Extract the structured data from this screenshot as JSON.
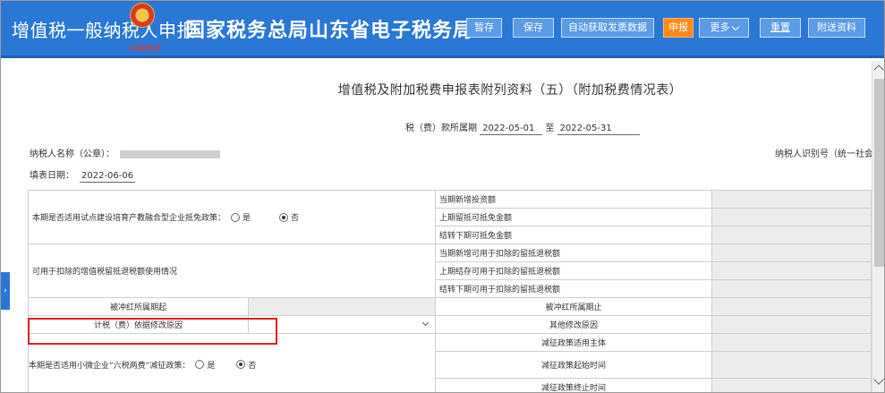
{
  "header": {
    "title_left": "增值税一般纳税人申报",
    "title_main": "国家税务总局山东省电子税务局",
    "emblem_sub": "中国税务",
    "buttons": {
      "stash": "暂存",
      "save": "保存",
      "auto_fetch": "自动获取发票数据",
      "declare": "申报",
      "more": "更多",
      "reset": "重置",
      "attach": "附送资料"
    },
    "accent_color": "#2a77d6",
    "active_color": "#ff8a1c"
  },
  "doc": {
    "title": "增值税及附加税费申报表附列资料（五）（附加税费情况表）",
    "period_label": "税（费）款所属期",
    "period_start": "2022-05-01",
    "period_to": "至",
    "period_end": "2022-05-31",
    "taxpayer_label": "纳税人名称（公章）：",
    "taxpayer_id_label": "纳税人识别号（统一社会信",
    "fill_date_label": "填表日期：",
    "fill_date": "2022-06-06"
  },
  "table": {
    "row1_label": "本期是否适用试点建设培育产教融合型企业抵免政策：",
    "yes": "是",
    "no": "否",
    "r1_items": [
      "当期新增投资额",
      "上期留抵可抵免金额",
      "结转下期可抵免金额"
    ],
    "row2_label": "可用于扣除的增值税留抵退税额使用情况",
    "r2_items": [
      "当期新增可用于扣除的留抵退税额",
      "上期结存可用于扣除的留抵退税额",
      "结转下期可用于扣除的留抵退税额"
    ],
    "red_start": "被冲红所属期起",
    "red_end": "被冲红所属期止",
    "modify_reason": "计税（费）依据修改原因",
    "other_reason": "其他修改原因",
    "row5_label": "本期是否适用小微企业“六税两费”减征政策：",
    "r5_items": [
      "减征政策适用主体",
      "减征政策起始时间",
      "减征政策终止时间"
    ]
  },
  "side_tab": "›"
}
